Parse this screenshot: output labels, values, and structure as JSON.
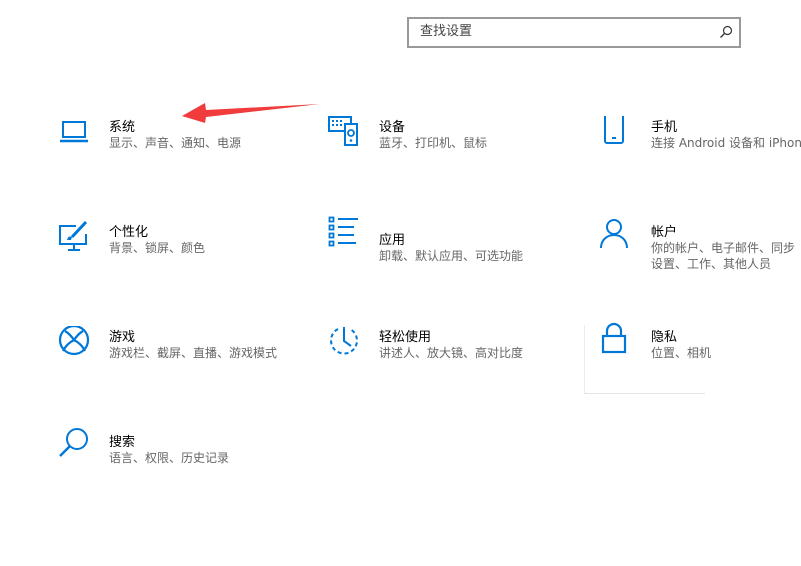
{
  "search": {
    "placeholder": "查找设置",
    "icon": "search-icon"
  },
  "accent": "#0078d7",
  "annotation_color": "#f03c3c",
  "tiles": [
    {
      "title": "系统",
      "subtitle": "显示、声音、通知、电源",
      "icon": "laptop-icon"
    },
    {
      "title": "设备",
      "subtitle": "蓝牙、打印机、鼠标",
      "icon": "keyboard-speaker-icon"
    },
    {
      "title": "手机",
      "subtitle": "连接 Android 设备和 iPhone",
      "icon": "phone-icon"
    },
    {
      "title": "个性化",
      "subtitle": "背景、锁屏、颜色",
      "icon": "personalization-icon"
    },
    {
      "title": "应用",
      "subtitle": "卸载、默认应用、可选功能",
      "icon": "apps-list-icon"
    },
    {
      "title": "帐户",
      "subtitle": "你的帐户、电子邮件、同步设置、工作、其他人员",
      "icon": "person-icon"
    },
    {
      "title": "游戏",
      "subtitle": "游戏栏、截屏、直播、游戏模式",
      "icon": "xbox-icon"
    },
    {
      "title": "轻松使用",
      "subtitle": "讲述人、放大镜、高对比度",
      "icon": "ease-of-access-icon"
    },
    {
      "title": "隐私",
      "subtitle": "位置、相机",
      "icon": "lock-icon"
    },
    {
      "title": "搜索",
      "subtitle": "语言、权限、历史记录",
      "icon": "search-icon"
    }
  ]
}
